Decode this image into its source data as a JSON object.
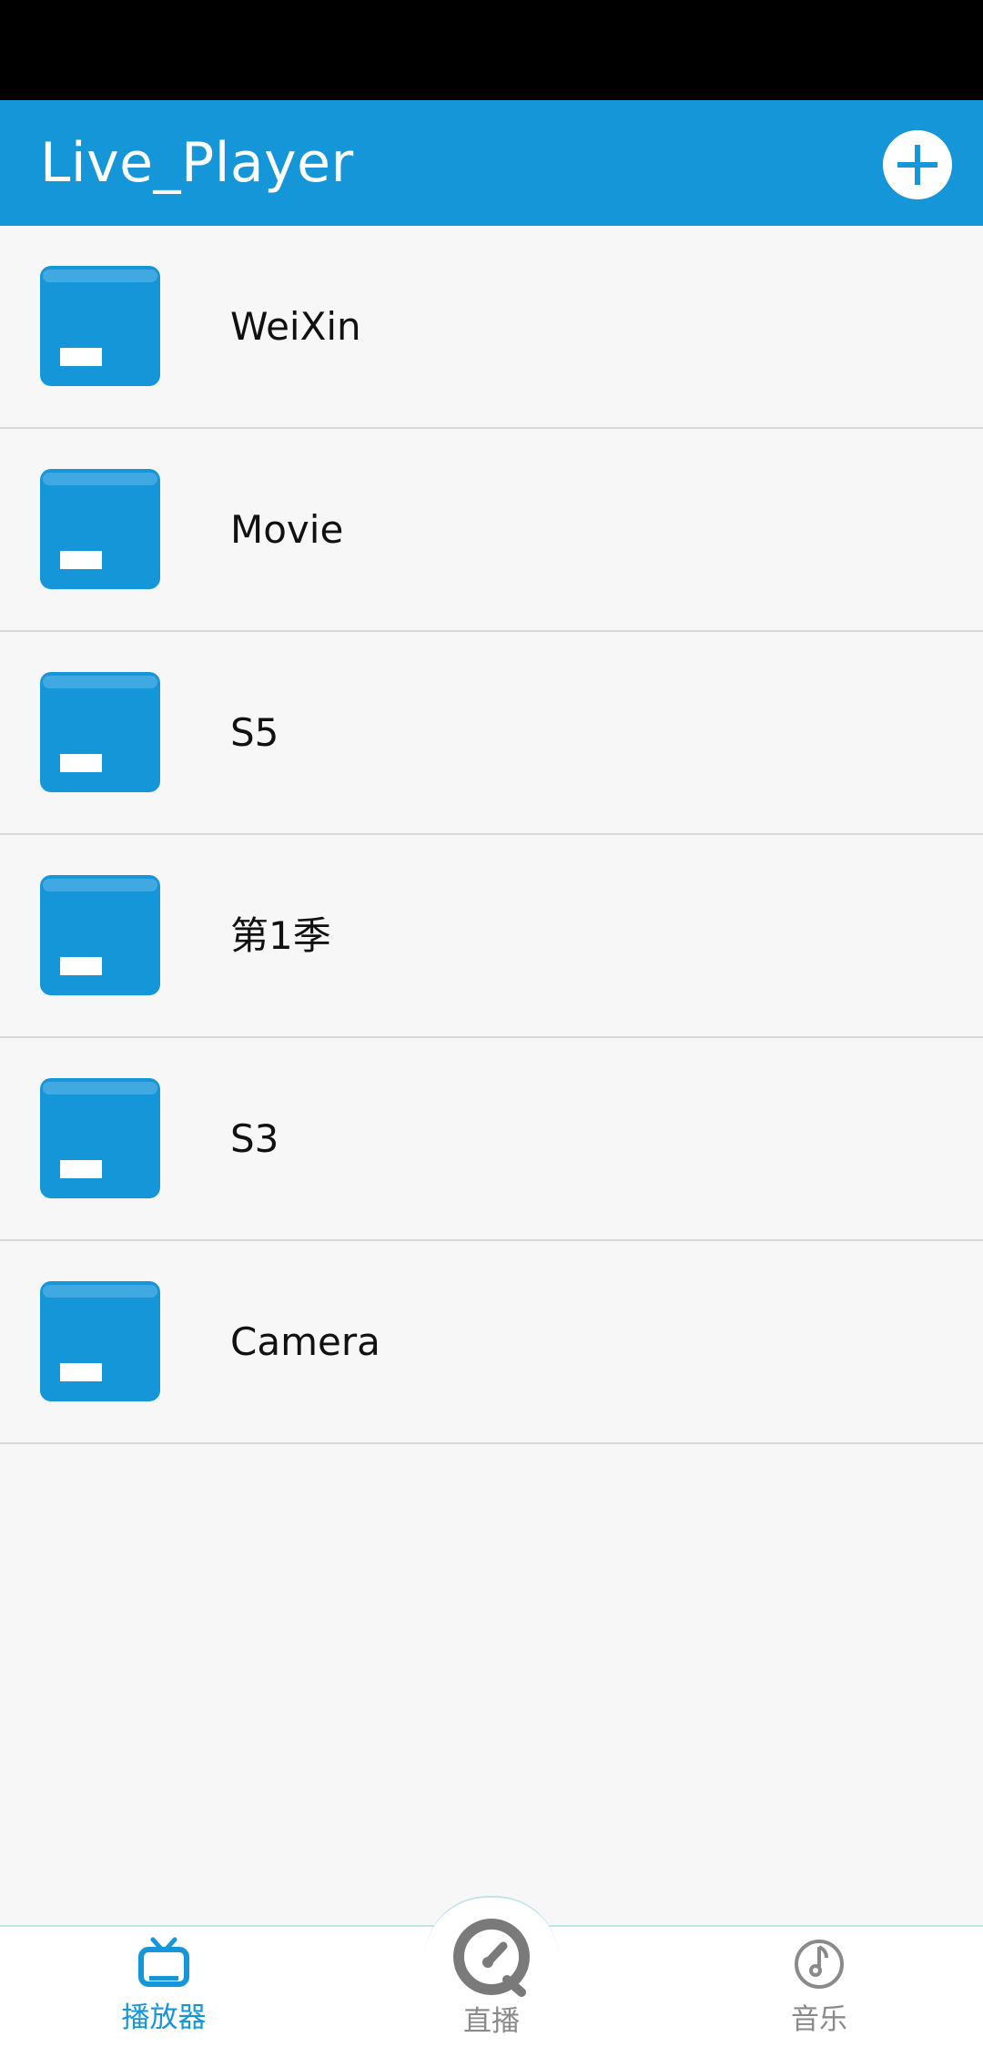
{
  "app": {
    "title": "Live_Player",
    "accent_color": "#1596d9",
    "add_icon": "plus-circle-icon"
  },
  "folders": [
    {
      "name": "WeiXin",
      "icon": "folder-icon"
    },
    {
      "name": "Movie",
      "icon": "folder-icon"
    },
    {
      "name": "S5",
      "icon": "folder-icon"
    },
    {
      "name": "第1季",
      "icon": "folder-icon"
    },
    {
      "name": "S3",
      "icon": "folder-icon"
    },
    {
      "name": "Camera",
      "icon": "folder-icon"
    }
  ],
  "bottom_nav": {
    "items": [
      {
        "label": "播放器",
        "icon": "tv-icon",
        "active": true
      },
      {
        "label": "直播",
        "icon": "live-dial-icon",
        "active": false
      },
      {
        "label": "音乐",
        "icon": "music-note-icon",
        "active": false
      }
    ],
    "active_color": "#1596d9",
    "inactive_color": "#8a8a8a"
  }
}
